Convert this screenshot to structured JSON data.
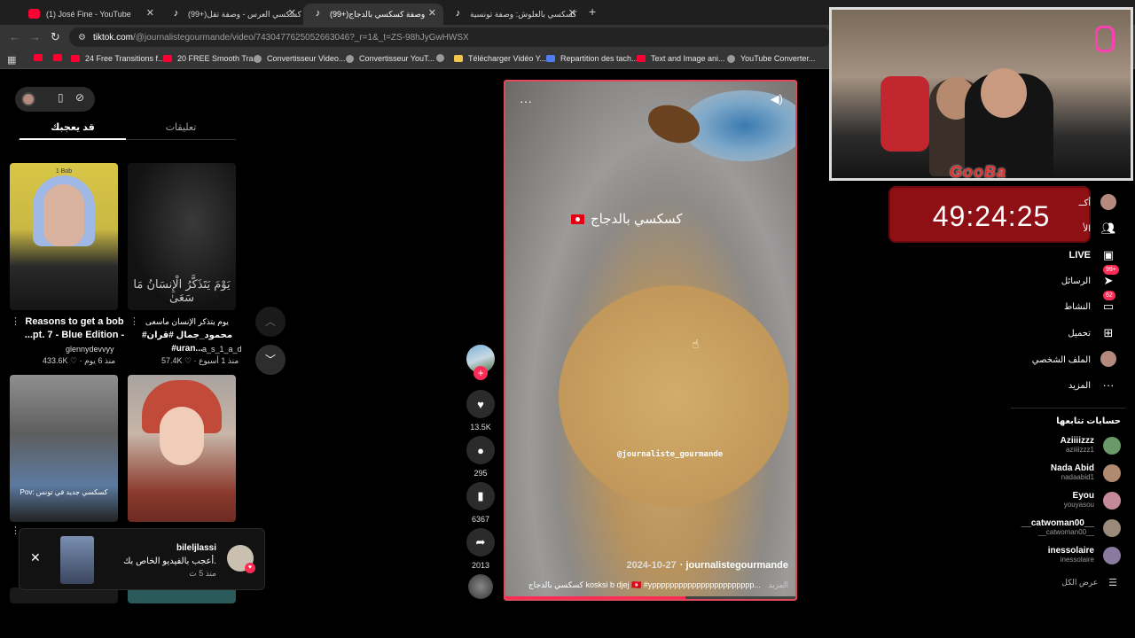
{
  "browser": {
    "tabs": [
      {
        "title": "(1) José Fine - YouTube",
        "icon": "youtube-icon"
      },
      {
        "title": "(99+)كسكسي العرس - وصفة تقل",
        "icon": "tiktok-icon"
      },
      {
        "title": "(99+)وصفة كسكسي بالدجاج",
        "icon": "tiktok-icon"
      },
      {
        "title": "كسكسي بالعلوش: وصفة تونسية",
        "icon": "tiktok-icon"
      }
    ],
    "new_tab": "+",
    "url_host": "tiktok.com",
    "url_rest": "/@journalistegourmande/video/7430477625052663046?_r=1&_t=ZS-98hJyGwHWSX",
    "bookmarks": [
      {
        "label": "",
        "icon": "youtube"
      },
      {
        "label": "",
        "icon": "youtube"
      },
      {
        "label": "24 Free Transitions f...",
        "icon": "youtube"
      },
      {
        "label": "20 FREE Smooth Tra...",
        "icon": "youtube"
      },
      {
        "label": "Convertisseur Video...",
        "icon": "globe"
      },
      {
        "label": "Convertisseur YouT...",
        "icon": "globe"
      },
      {
        "label": "",
        "icon": "globe"
      },
      {
        "label": "Télécharger Vidéo Y...",
        "icon": "download"
      },
      {
        "label": "Repartition des tach...",
        "icon": "docs"
      },
      {
        "label": "Text and Image ani...",
        "icon": "youtube"
      },
      {
        "label": "YouTube Converter...",
        "icon": "globe"
      }
    ]
  },
  "left_panel": {
    "tabs": [
      "قد يعجبك",
      "تعليقات"
    ],
    "videos": [
      {
        "title1": "Reasons to get a bob",
        "title2": "...pt. 7 - Blue Edition -",
        "author": "glennydevvyy",
        "meta": "433.6K ♡ · منذ 6 يوم",
        "thumb_text": "1 Bob"
      },
      {
        "title1": "يوم يتذكر الإنسان ماسعى",
        "title2": "#محمود_جمال #قران #uran...",
        "author": "a_s_1_a_d",
        "meta": "57.4K ♡ · منذ 1 أسبوع",
        "thumb_text": "يَوْمَ يَتَذَكَّرُ الْإِنسَانُ مَا سَعَىٰ"
      },
      {
        "thumb_text": "Pov: كسكسي جديد في تونس"
      },
      {
        "thumb_text": ""
      }
    ],
    "notification": {
      "name": "bileljlassi",
      "message": "أعجب بالفيديو الخاص بك.",
      "time": "منذ 5 ث"
    }
  },
  "video": {
    "overlay_title": "كسكسي بالدجاج",
    "watermark": "@journaliste_gourmande",
    "author": "journalistegourmande",
    "date": "2024-10-27",
    "description": "كسكسي بالدجاج kosksi b djej 🇹🇳 #yppppppppppppppppppppppp...",
    "more": "المزيد",
    "progress": 0.62,
    "likes": "13.5K",
    "comments": "295",
    "saves": "6367",
    "shares": "2013"
  },
  "stream": {
    "brand": "GooBa",
    "timer": "49:24:25"
  },
  "right_nav": [
    {
      "label": "أكــ",
      "icon": "avatar"
    },
    {
      "label": "الأ",
      "icon": "users-icon"
    },
    {
      "label": "LIVE",
      "icon": "live-icon"
    },
    {
      "label": "الرسائل",
      "icon": "paper-plane-icon",
      "badge": "99+"
    },
    {
      "label": "النشاط",
      "icon": "message-icon",
      "badge": "62"
    },
    {
      "label": "تحميل",
      "icon": "upload-icon"
    },
    {
      "label": "الملف الشخصي",
      "icon": "avatar"
    },
    {
      "label": "المزيد",
      "icon": "more-icon"
    }
  ],
  "following": {
    "heading": "حسابات تتابعها",
    "accounts": [
      {
        "name": "Aziiiizzz",
        "user": "aziiiizzz1",
        "color": "#6a9a6a"
      },
      {
        "name": "Nada Abid",
        "user": "nadaabid1",
        "color": "#b08a70"
      },
      {
        "name": "Eyou",
        "user": "youyasou",
        "color": "#c48a9a"
      },
      {
        "name": "__catwoman00__",
        "user": "__catwoman00__",
        "color": "#9a8a7a"
      },
      {
        "name": "inessolaire",
        "user": "inessolaire",
        "color": "#8a7aa0"
      }
    ],
    "see_all": "عرض الكل"
  }
}
